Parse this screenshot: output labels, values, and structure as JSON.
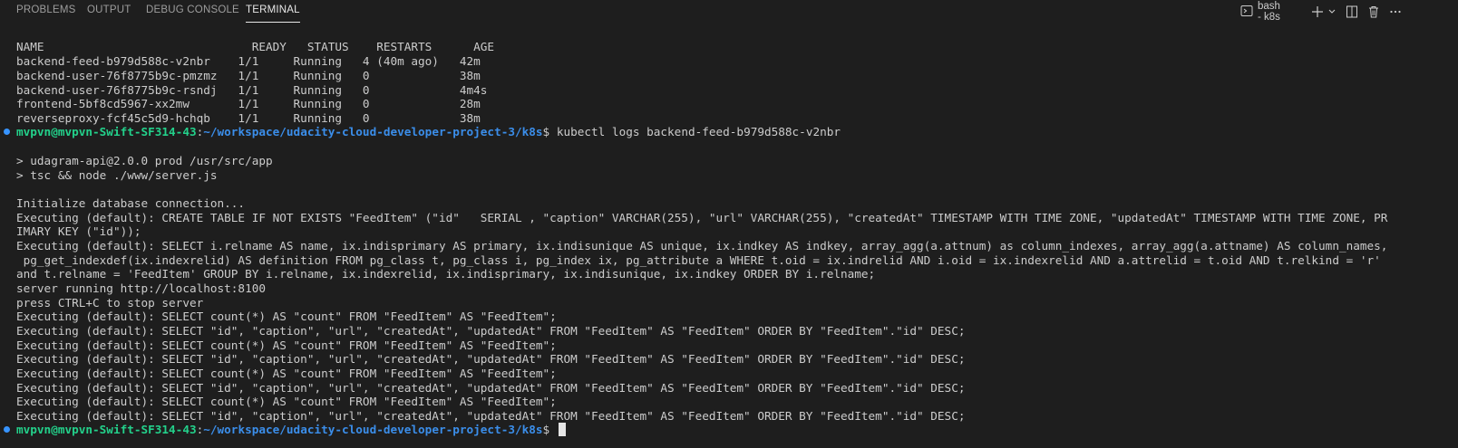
{
  "panel": {
    "tabs": [
      {
        "label": "PROBLEMS",
        "active": false
      },
      {
        "label": "OUTPUT",
        "active": false
      },
      {
        "label": "DEBUG CONSOLE",
        "active": false
      },
      {
        "label": "TERMINAL",
        "active": true
      }
    ],
    "terminal_name": "bash - k8s",
    "icons": [
      "terminal-icon",
      "plus-icon",
      "chevron-down-icon",
      "split-icon",
      "trash-icon",
      "more-icon"
    ]
  },
  "colors": {
    "background": "#1e1e1e",
    "prompt_user": "#23d18b",
    "prompt_path": "#3b8eea",
    "active_tab": "#e7e7e7"
  },
  "terminal": {
    "pods_header": "NAME                              READY   STATUS    RESTARTS      AGE",
    "pods": [
      "backend-feed-b979d588c-v2nbr    1/1     Running   4 (40m ago)   42m",
      "backend-user-76f8775b9c-pmzmz   1/1     Running   0             38m",
      "backend-user-76f8775b9c-rsndj   1/1     Running   0             4m4s",
      "frontend-5bf8cd5967-xx2mw       1/1     Running   0             28m",
      "reverseproxy-fcf45c5d9-hchqb    1/1     Running   0             38m"
    ],
    "prompt_user": "mvpvn@mvpvn-Swift-SF314-43",
    "prompt_path": "~/workspace/udacity-cloud-developer-project-3/k8s",
    "prompt_symbol": "$ ",
    "command": "kubectl logs backend-feed-b979d588c-v2nbr",
    "log_lines": [
      "> udagram-api@2.0.0 prod /usr/src/app",
      "> tsc && node ./www/server.js",
      "",
      "Initialize database connection...",
      "Executing (default): CREATE TABLE IF NOT EXISTS \"FeedItem\" (\"id\"   SERIAL , \"caption\" VARCHAR(255), \"url\" VARCHAR(255), \"createdAt\" TIMESTAMP WITH TIME ZONE, \"updatedAt\" TIMESTAMP WITH TIME ZONE, PR",
      "IMARY KEY (\"id\"));",
      "Executing (default): SELECT i.relname AS name, ix.indisprimary AS primary, ix.indisunique AS unique, ix.indkey AS indkey, array_agg(a.attnum) as column_indexes, array_agg(a.attname) AS column_names,",
      " pg_get_indexdef(ix.indexrelid) AS definition FROM pg_class t, pg_class i, pg_index ix, pg_attribute a WHERE t.oid = ix.indrelid AND i.oid = ix.indexrelid AND a.attrelid = t.oid AND t.relkind = 'r'",
      "and t.relname = 'FeedItem' GROUP BY i.relname, ix.indexrelid, ix.indisprimary, ix.indisunique, ix.indkey ORDER BY i.relname;",
      "server running http://localhost:8100",
      "press CTRL+C to stop server",
      "Executing (default): SELECT count(*) AS \"count\" FROM \"FeedItem\" AS \"FeedItem\";",
      "Executing (default): SELECT \"id\", \"caption\", \"url\", \"createdAt\", \"updatedAt\" FROM \"FeedItem\" AS \"FeedItem\" ORDER BY \"FeedItem\".\"id\" DESC;",
      "Executing (default): SELECT count(*) AS \"count\" FROM \"FeedItem\" AS \"FeedItem\";",
      "Executing (default): SELECT \"id\", \"caption\", \"url\", \"createdAt\", \"updatedAt\" FROM \"FeedItem\" AS \"FeedItem\" ORDER BY \"FeedItem\".\"id\" DESC;",
      "Executing (default): SELECT count(*) AS \"count\" FROM \"FeedItem\" AS \"FeedItem\";",
      "Executing (default): SELECT \"id\", \"caption\", \"url\", \"createdAt\", \"updatedAt\" FROM \"FeedItem\" AS \"FeedItem\" ORDER BY \"FeedItem\".\"id\" DESC;",
      "Executing (default): SELECT count(*) AS \"count\" FROM \"FeedItem\" AS \"FeedItem\";",
      "Executing (default): SELECT \"id\", \"caption\", \"url\", \"createdAt\", \"updatedAt\" FROM \"FeedItem\" AS \"FeedItem\" ORDER BY \"FeedItem\".\"id\" DESC;"
    ]
  }
}
